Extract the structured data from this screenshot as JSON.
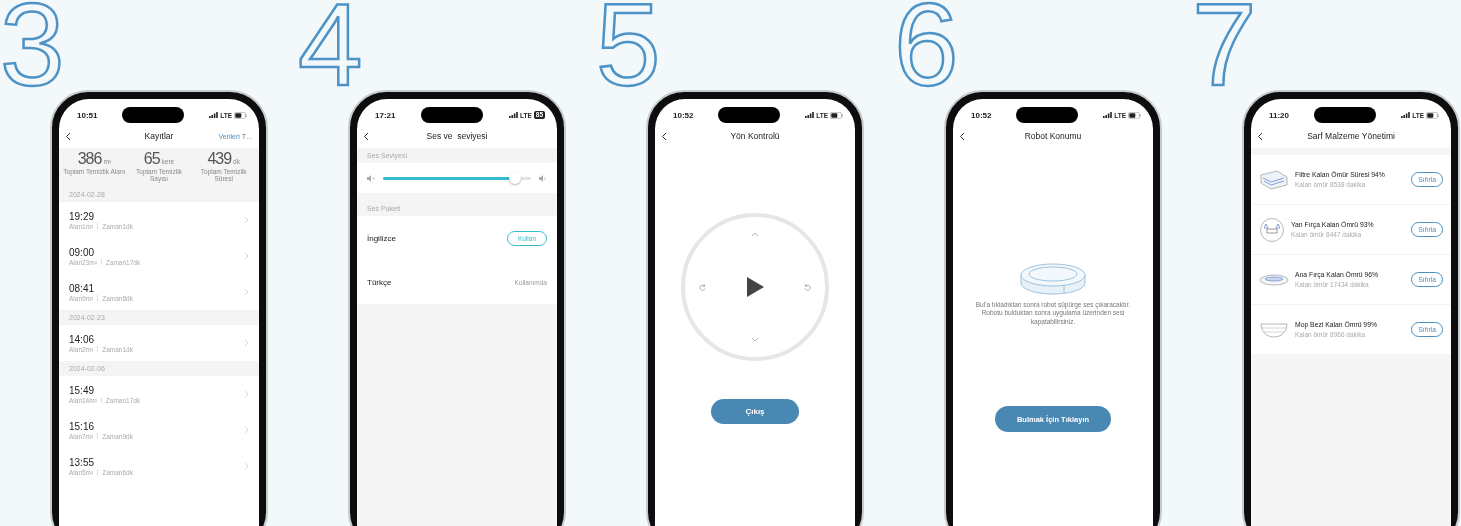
{
  "phones": [
    {
      "kind": "records",
      "step": "3",
      "status": {
        "time": "10:51",
        "network": "LTE"
      },
      "title": "Kayıtlar",
      "action": "Verileri T…",
      "stats": [
        {
          "value": "386",
          "unit": "m²",
          "label": "Toplam Temizlik Alanı"
        },
        {
          "value": "65",
          "unit": "kere",
          "label": "Toplam Temizlik Sayısı"
        },
        {
          "value": "439",
          "unit": "dk",
          "label": "Toplam Temizlik Süresi"
        }
      ],
      "groups": [
        {
          "date": "2024-02-28",
          "entries": [
            {
              "time": "19:29",
              "area": "Alan1m²",
              "duration": "Zaman1dk"
            },
            {
              "time": "09:00",
              "area": "Alan23m²",
              "duration": "Zaman17dk"
            },
            {
              "time": "08:41",
              "area": "Alan9m²",
              "duration": "Zaman8dk"
            }
          ]
        },
        {
          "date": "2024-02-23",
          "entries": [
            {
              "time": "14:06",
              "area": "Alan2m²",
              "duration": "Zaman1dk"
            }
          ]
        },
        {
          "date": "2024-02-06",
          "entries": [
            {
              "time": "15:49",
              "area": "Alan14m²",
              "duration": "Zaman17dk"
            },
            {
              "time": "15:16",
              "area": "Alan7m²",
              "duration": "Zaman9dk"
            },
            {
              "time": "13:55",
              "area": "Alan5m²",
              "duration": "Zaman6dk"
            }
          ]
        }
      ]
    },
    {
      "kind": "sound",
      "step": "4",
      "status": {
        "time": "17:21",
        "network": "LTE",
        "battery": "85"
      },
      "title": "Ses ve  seviyesi",
      "volume_label": "Ses Seviyesi",
      "volume": {
        "level": 0.93
      },
      "packs_label": "Ses Paketi",
      "packs": [
        {
          "name": "İngilizce",
          "action": "Kullan",
          "in_use": false
        },
        {
          "name": "Türkçe",
          "action": "Kullanımda",
          "in_use": true
        }
      ]
    },
    {
      "kind": "direction",
      "step": "5",
      "status": {
        "time": "10:52",
        "network": "LTE"
      },
      "title": "Yön Kontrolü",
      "button": "Çıkış"
    },
    {
      "kind": "locate",
      "step": "6",
      "status": {
        "time": "10:52",
        "network": "LTE"
      },
      "title": "Robot Konumu",
      "message": "Bul'a tıkladıktan sonra robot süpürge ses çıkaracaktır. Robotu bulduktan sonra uygulama üzerinden sesi kapatabilirsiniz.",
      "button": "Bulmak İçin Tıklayın"
    },
    {
      "kind": "consumables",
      "step": "7",
      "status": {
        "time": "11:20",
        "network": "LTE"
      },
      "title": "Sarf Malzeme Yönetimi",
      "items": [
        {
          "kind": "filter",
          "name": "Filtre Kalan Ömür Süresi 94%",
          "remaining": "Kalan ömür 8538 dakika",
          "action": "Sıfırla"
        },
        {
          "kind": "side_brush",
          "name": "Yan Fırça Kalan Ömrü 93%",
          "remaining": "Kalan ömür 8447 dakika",
          "action": "Sıfırla"
        },
        {
          "kind": "main_brush",
          "name": "Ana Fırça Kalan Ömrü 96%",
          "remaining": "Kalan ömür 17434 dakika",
          "action": "Sıfırla"
        },
        {
          "kind": "mop",
          "name": "Mop Bezi Kalan Ömrü 99%",
          "remaining": "Kalan ömür 8966 dakika",
          "action": "Sıfırla"
        }
      ]
    }
  ]
}
